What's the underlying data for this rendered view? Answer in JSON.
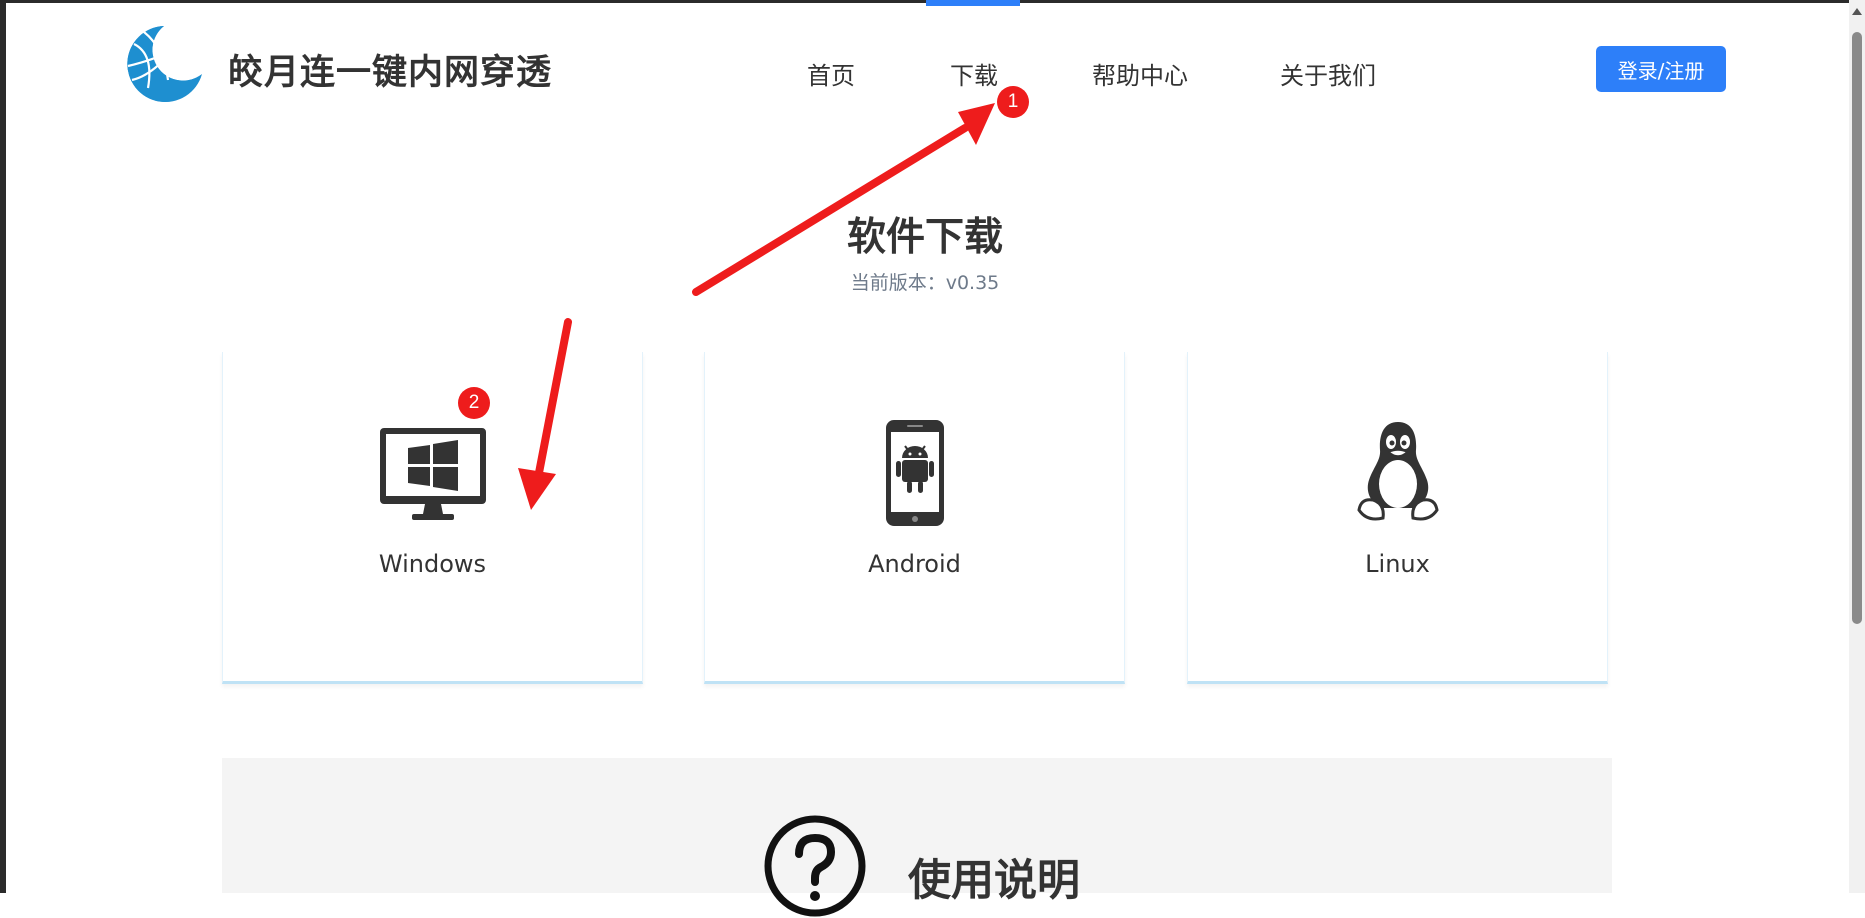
{
  "header": {
    "brand": "皎月连一键内网穿透",
    "nav": {
      "home": "首页",
      "download": "下载",
      "help": "帮助中心",
      "about": "关于我们"
    },
    "login_label": "登录/注册"
  },
  "main": {
    "title": "软件下载",
    "version_label": "当前版本：",
    "version_value": "v0.35"
  },
  "downloads": [
    {
      "label": "Windows",
      "icon": "windows-monitor-icon"
    },
    {
      "label": "Android",
      "icon": "android-phone-icon"
    },
    {
      "label": "Linux",
      "icon": "linux-penguin-icon"
    }
  ],
  "instructions": {
    "title": "使用说明",
    "icon": "question-circle-icon"
  },
  "annotations": {
    "badge_1": "1",
    "badge_2": "2",
    "color": "#ee1c1c"
  },
  "colors": {
    "accent": "#2d7ff9",
    "logo": "#1e8fd0"
  }
}
